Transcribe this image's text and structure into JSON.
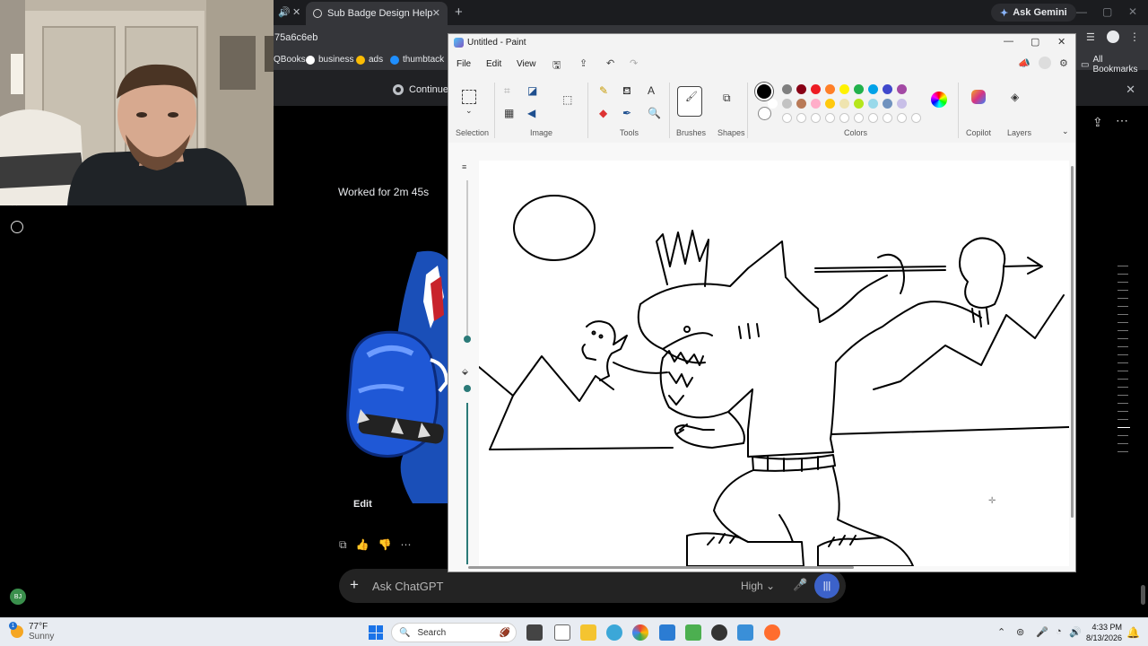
{
  "browser": {
    "active_tab_title": "Sub Badge Design Help",
    "url_fragment": "75a6c6eb",
    "ask_gemini_label": "Ask Gemini",
    "bookmarks": [
      "QBooks",
      "business",
      "ads",
      "thumbtack"
    ],
    "all_bookmarks_label": "All Bookmarks",
    "infobar_text": "Continue where"
  },
  "chat": {
    "worked_label": "Worked for 2m 45s",
    "edit_label": "Edit",
    "composer_placeholder": "Ask ChatGPT",
    "model_label": "High",
    "user_initials": "BJ"
  },
  "paint": {
    "window_title": "Untitled - Paint",
    "menu": [
      "File",
      "Edit",
      "View"
    ],
    "ribbon_groups": {
      "selection": "Selection",
      "image": "Image",
      "tools": "Tools",
      "brushes": "Brushes",
      "shapes": "Shapes",
      "colors": "Colors",
      "copilot": "Copilot",
      "layers": "Layers"
    },
    "palette_row1": [
      "#000000",
      "#7f7f7f",
      "#880015",
      "#ed1c24",
      "#ff7f27",
      "#fff200",
      "#22b14c",
      "#00a2e8",
      "#3f48cc",
      "#a349a4"
    ],
    "palette_row2": [
      "#ffffff",
      "#c3c3c3",
      "#b97a57",
      "#ffaec9",
      "#ffc90e",
      "#efe4b0",
      "#b5e61d",
      "#99d9ea",
      "#7092be",
      "#c8bfe7"
    ],
    "primary_color": "#000000",
    "secondary_color": "#ffffff"
  },
  "taskbar": {
    "temperature": "77°F",
    "weather_condition": "Sunny",
    "weather_badge": "1",
    "search_label": "Search",
    "time": "4:33 PM",
    "date": "8/13/2026"
  }
}
